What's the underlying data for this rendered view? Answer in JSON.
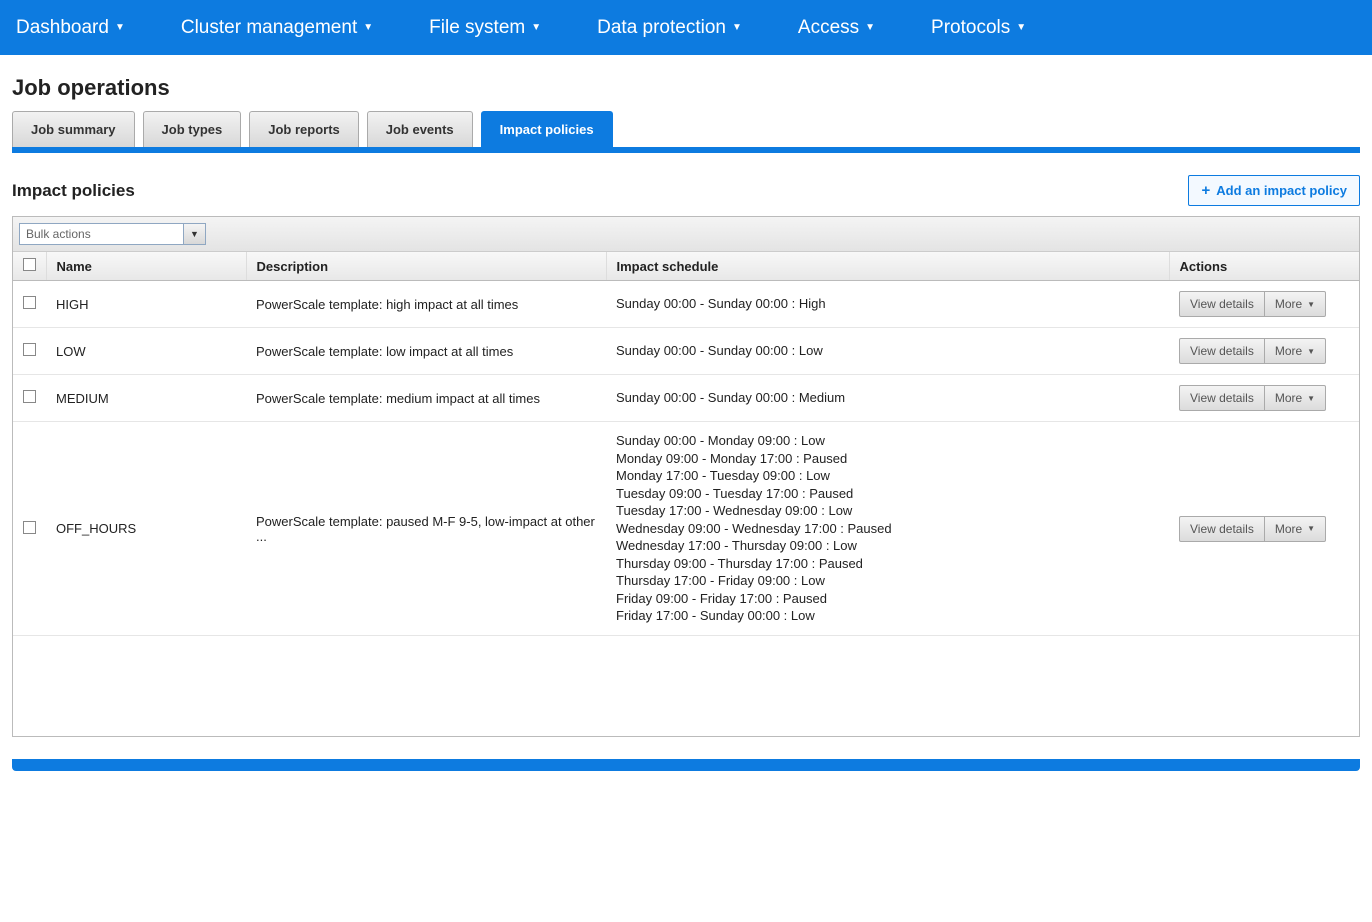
{
  "nav": {
    "items": [
      {
        "label": "Dashboard"
      },
      {
        "label": "Cluster management"
      },
      {
        "label": "File system"
      },
      {
        "label": "Data protection"
      },
      {
        "label": "Access"
      },
      {
        "label": "Protocols"
      }
    ]
  },
  "page": {
    "title": "Job operations"
  },
  "tabs": [
    {
      "label": "Job summary"
    },
    {
      "label": "Job types"
    },
    {
      "label": "Job reports"
    },
    {
      "label": "Job events"
    },
    {
      "label": "Impact policies",
      "active": true
    }
  ],
  "section": {
    "title": "Impact policies",
    "add_button_label": "Add an impact policy"
  },
  "toolbar": {
    "bulk_actions_label": "Bulk actions"
  },
  "table": {
    "columns": {
      "name": "Name",
      "description": "Description",
      "impact_schedule": "Impact schedule",
      "actions": "Actions"
    },
    "action_labels": {
      "view_details": "View details",
      "more": "More"
    },
    "rows": [
      {
        "name": "HIGH",
        "description": "PowerScale template: high impact at all times",
        "schedule": [
          "Sunday 00:00 - Sunday 00:00 : High"
        ]
      },
      {
        "name": "LOW",
        "description": "PowerScale template: low impact at all times",
        "schedule": [
          "Sunday 00:00 - Sunday 00:00 : Low"
        ]
      },
      {
        "name": "MEDIUM",
        "description": "PowerScale template: medium impact at all times",
        "schedule": [
          "Sunday 00:00 - Sunday 00:00 : Medium"
        ]
      },
      {
        "name": "OFF_HOURS",
        "description": "PowerScale template: paused M-F 9-5, low-impact at other ...",
        "schedule": [
          "Sunday 00:00 - Monday 09:00 : Low",
          "Monday 09:00 - Monday 17:00 : Paused",
          "Monday 17:00 - Tuesday 09:00 : Low",
          "Tuesday 09:00 - Tuesday 17:00 : Paused",
          "Tuesday 17:00 - Wednesday 09:00 : Low",
          "Wednesday 09:00 - Wednesday 17:00 : Paused",
          "Wednesday 17:00 - Thursday 09:00 : Low",
          "Thursday 09:00 - Thursday 17:00 : Paused",
          "Thursday 17:00 - Friday 09:00 : Low",
          "Friday 09:00 - Friday 17:00 : Paused",
          "Friday 17:00 - Sunday 00:00 : Low"
        ]
      }
    ]
  }
}
